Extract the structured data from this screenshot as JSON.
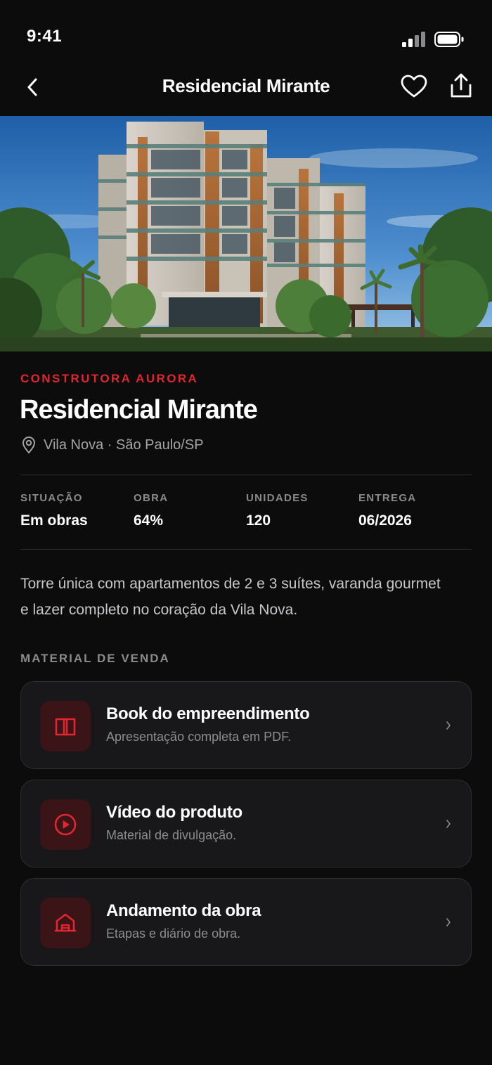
{
  "status": {
    "time": "9:41"
  },
  "nav": {
    "title": "Residencial Mirante"
  },
  "hero": {
    "image": "apartment-building-photo"
  },
  "project": {
    "developer": "CONSTRUTORA AURORA",
    "name": "Residencial Mirante",
    "location": "Vila Nova · São Paulo/SP",
    "description": "Torre única com apartamentos de 2 e 3 suítes, varanda gourmet e lazer completo no coração da Vila Nova."
  },
  "stats": [
    {
      "label": "SITUAÇÃO",
      "value": "Em obras"
    },
    {
      "label": "OBRA",
      "value": "64%"
    },
    {
      "label": "UNIDADES",
      "value": "120"
    },
    {
      "label": "ENTREGA",
      "value": "06/2026"
    }
  ],
  "sales": {
    "title": "MATERIAL DE VENDA",
    "items": [
      {
        "title": "Book do empreendimento",
        "subtitle": "Apresentação completa em PDF.",
        "icon": "book-icon"
      },
      {
        "title": "Vídeo do produto",
        "subtitle": "Material de divulgação.",
        "icon": "play-icon"
      },
      {
        "title": "Andamento da obra",
        "subtitle": "Etapas e diário de obra.",
        "icon": "construction-icon"
      }
    ]
  },
  "colors": {
    "accent": "#e0262f",
    "background": "#0d0c0d",
    "card": "#18171a",
    "icon_bg": "#3a1416"
  }
}
